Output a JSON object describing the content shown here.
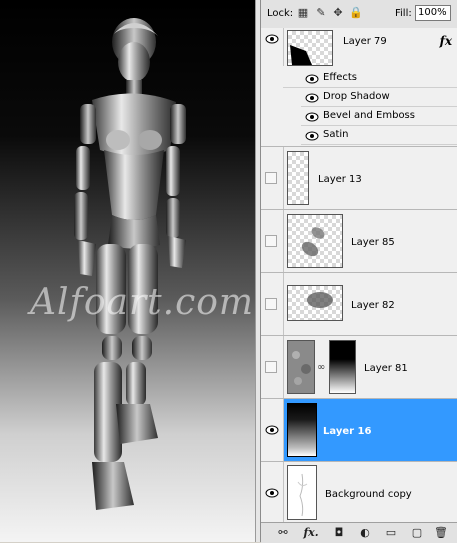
{
  "canvas": {
    "watermark": "Alfoart.com"
  },
  "layers_panel": {
    "lock_label": "Lock:",
    "fill_label": "Fill:",
    "fill_value": "100%",
    "layers": [
      {
        "name": "Layer 79",
        "visible": true,
        "has_fx": true,
        "fx_label": "fx"
      },
      {
        "name": "Layer 13",
        "visible": false
      },
      {
        "name": "Layer 85",
        "visible": false
      },
      {
        "name": "Layer 82",
        "visible": false
      },
      {
        "name": "Layer 81",
        "visible": false,
        "has_mask": true
      },
      {
        "name": "Layer 16",
        "visible": true,
        "selected": true
      },
      {
        "name": "Background copy",
        "visible": true
      }
    ],
    "effects": {
      "header": "Effects",
      "items": [
        "Drop Shadow",
        "Bevel and Emboss",
        "Satin"
      ]
    },
    "toolbar": {
      "link": "⚯",
      "fx": "fx.",
      "mask": "◘",
      "adjust": "◐",
      "group": "▭",
      "new": "▢",
      "delete": "🗑"
    }
  },
  "colors": {
    "selection": "#3399ff",
    "panel_bg": "#f0f0f0"
  }
}
